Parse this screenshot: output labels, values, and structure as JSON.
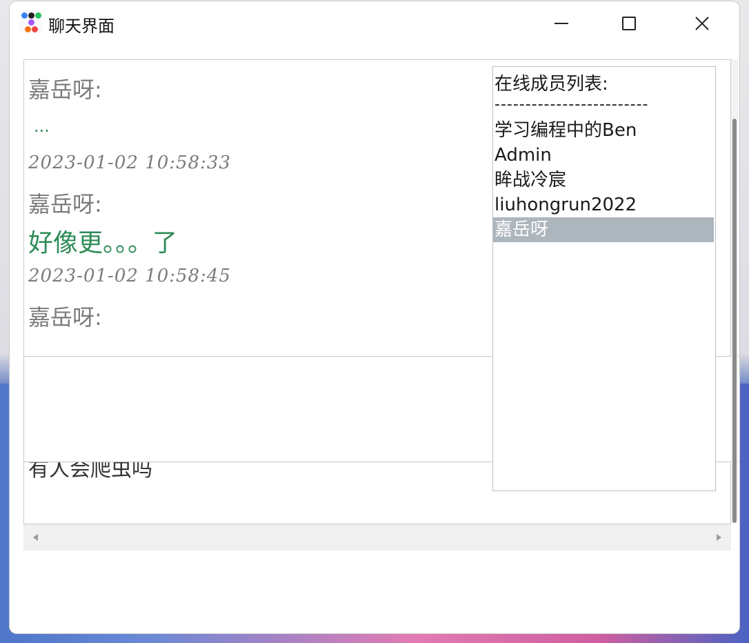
{
  "window": {
    "title": "聊天界面",
    "icon": "app-dots-icon",
    "controls": {
      "minimize": "minimize-icon",
      "maximize": "maximize-icon",
      "close": "close-icon"
    }
  },
  "messages": [
    {
      "sender": "嘉岳呀:",
      "text": "..."
    },
    {
      "time": "2023-01-02 10:58:33"
    },
    {
      "sender": "嘉岳呀:",
      "text": "好像更。。。了"
    },
    {
      "time": "2023-01-02 10:58:45"
    },
    {
      "sender": "嘉岳呀:",
      "text": "有人会爬虫吗"
    }
  ],
  "member_list": {
    "header": "在线成员列表:",
    "separator": "-------------------------",
    "members": [
      "学习编程中的Ben",
      "Admin",
      "眸战冷宸",
      "liuhongrun2022",
      "嘉岳呀"
    ],
    "selected_index": 4
  },
  "colors": {
    "message_text": "#2e8b57",
    "meta_text": "#7b7b7b",
    "selected_bg": "#adb5bd"
  }
}
